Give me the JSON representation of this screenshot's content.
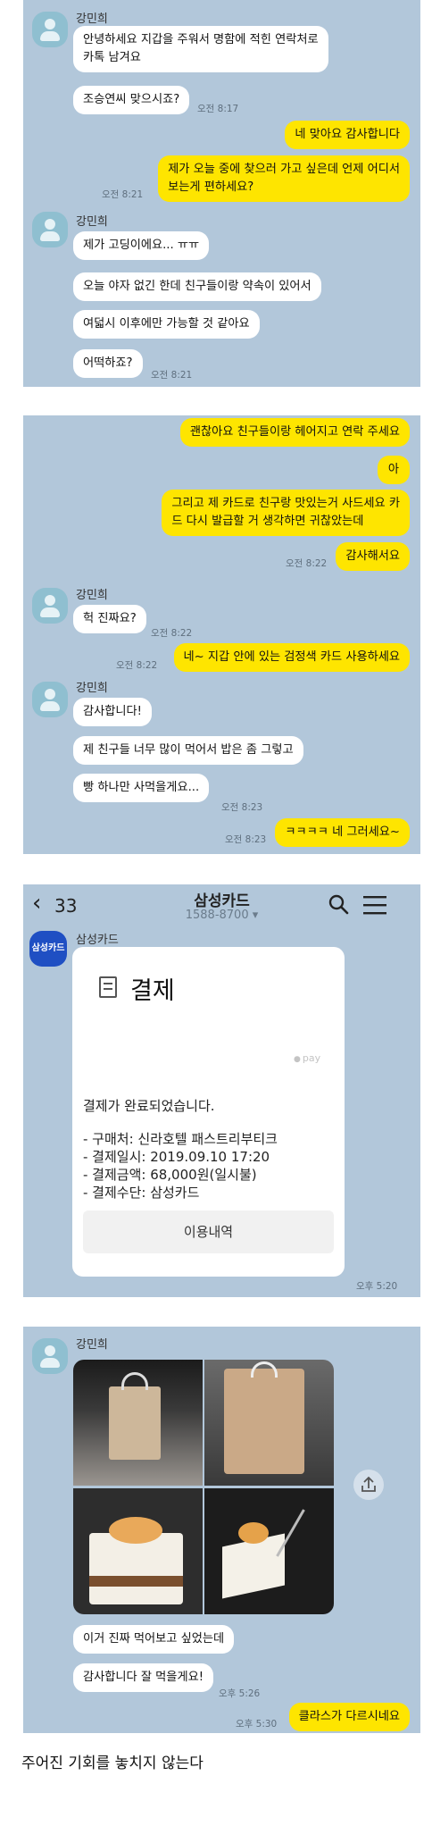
{
  "panel1": {
    "sender": "강민희",
    "m1_l1": "안녕하세요 지갑을 주워서 명함에 적힌 연락처로",
    "m1_l2": "카톡 남겨요",
    "m2": "조승연씨 맞으시죠?",
    "t1": "오전 8:17",
    "m3": "네 맞아요 감사합니다",
    "m4_l1": "제가 오늘 중에 찾으러 가고 싶은데 언제 어디서",
    "m4_l2": "보는게 편하세요?",
    "t2": "오전 8:21",
    "sender2": "강민희",
    "m5": "제가 고딩이에요... ㅠㅠ",
    "m6": "오늘 야자 없긴 한데 친구들이랑 약속이 있어서",
    "m7": "여덟시 이후에만 가능할 것 같아요",
    "m8": "어떡하죠?",
    "t3": "오전 8:21"
  },
  "panel2": {
    "m1": "괜찮아요 친구들이랑 헤어지고 연락 주세요",
    "m2": "아",
    "m3_l1": "그리고 제 카드로 친구랑 맛있는거 사드세요 카",
    "m3_l2": "드 다시 발급할 거 생각하면 귀찮았는데",
    "t1": "오전 8:22",
    "m4": "감사해서요",
    "sender": "강민희",
    "m5": "헉 진짜요?",
    "t2": "오전 8:22",
    "t3": "오전 8:22",
    "m6": "네~ 지갑 안에 있는 검정색 카드 사용하세요",
    "sender2": "강민희",
    "m7": "감사합니다!",
    "m8": "제 친구들 너무 많이 먹어서 밥은 좀 그렇고",
    "m9": "빵 하나만 사먹을게요...",
    "t4": "오전 8:23",
    "t5": "오전 8:23",
    "m10": "ㅋㅋㅋㅋ 네 그러세요~"
  },
  "panel3": {
    "back_count": "33",
    "title": "삼성카드",
    "subtitle": "1588-8700 ▾",
    "avatar_text": "삼성카드",
    "sender": "삼성카드",
    "card_title": "결제",
    "pay_mark": "pay",
    "message": "결제가 완료되었습니다.",
    "details": [
      "- 구매처: 신라호텔 패스트리부티크",
      "- 결제일시: 2019.09.10 17:20",
      "- 결제금액: 68,000원(일시불)",
      "- 결제수단: 삼성카드"
    ],
    "history_button": "이용내역",
    "time": "오후 5:20"
  },
  "panel4": {
    "sender": "강민희",
    "m1": "이거 진짜 먹어보고 싶었는데",
    "m2": "감사합니다 잘 먹을게요!",
    "t1": "오후 5:26",
    "t2": "오후 5:30",
    "m3": "클라스가 다르시네요"
  },
  "caption": "주어진 기회를 놓치지 않는다",
  "colors": {
    "chat_background": "#b2c7da",
    "my_bubble": "#fee500",
    "their_bubble": "#ffffff",
    "samsung_blue": "#1f4fc3"
  }
}
